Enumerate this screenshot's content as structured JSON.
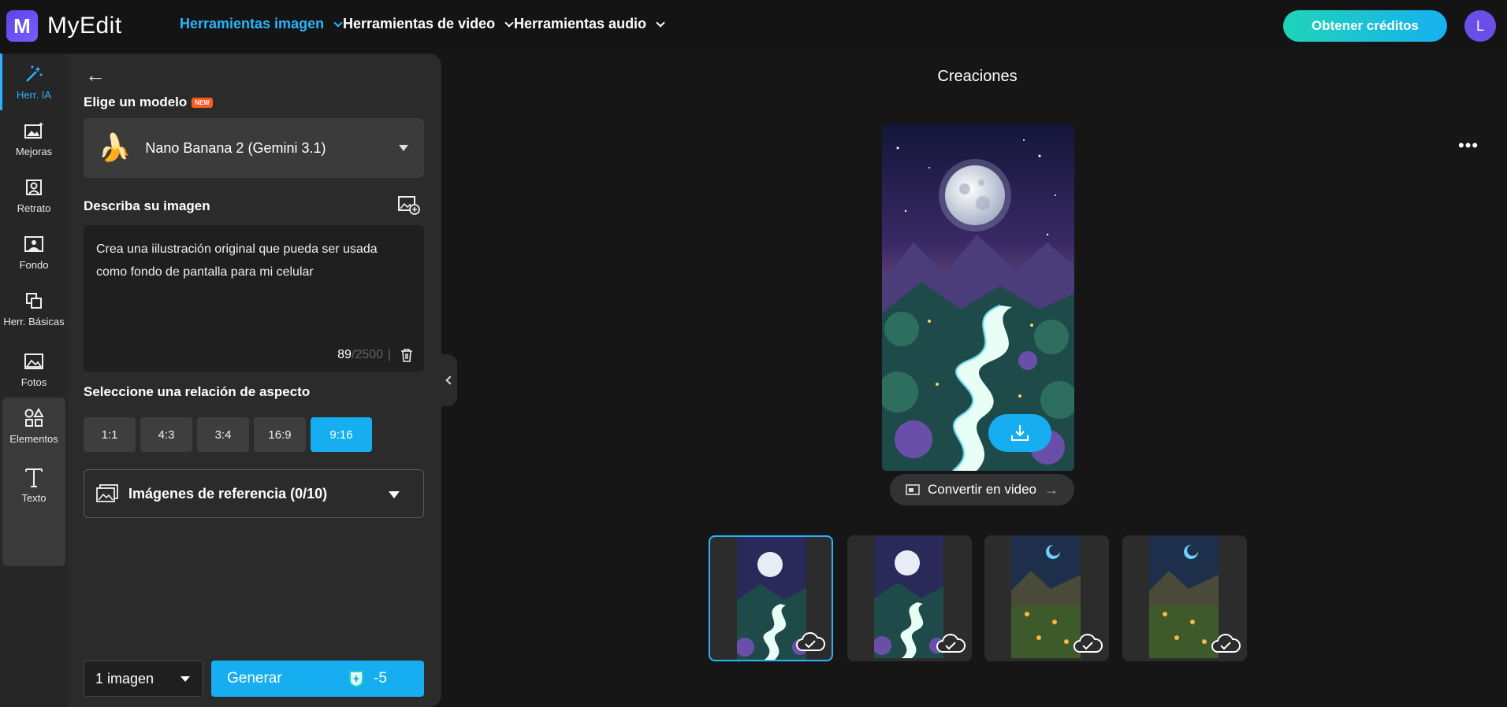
{
  "app": {
    "name": "MyEdit",
    "logo_letter": "M",
    "avatar_letter": "L"
  },
  "nav": {
    "image_tools": "Herramientas imagen",
    "video_tools": "Herramientas de video",
    "audio_tools": "Herramientas audio",
    "credits_button": "Obtener créditos"
  },
  "rail": {
    "items": [
      {
        "label": "Herr. IA",
        "icon": "magic-wand-icon"
      },
      {
        "label": "Mejoras",
        "icon": "image-enhance-icon"
      },
      {
        "label": "Retrato",
        "icon": "portrait-icon"
      },
      {
        "label": "Fondo",
        "icon": "background-icon"
      },
      {
        "label": "Herr. Básicas",
        "icon": "crop-icon"
      },
      {
        "label": "Fotos",
        "icon": "photo-icon"
      },
      {
        "label": "Elementos",
        "icon": "shapes-icon"
      },
      {
        "label": "Texto",
        "icon": "text-icon"
      }
    ]
  },
  "panel": {
    "model_label": "Elige un modelo",
    "new_badge": "NEW",
    "model_name": "Nano Banana 2 (Gemini 3.1)",
    "model_emoji": "🍌",
    "describe_label": "Describa su imagen",
    "prompt": "Crea una iilustración original que pueda ser usada como fondo de pantalla para mi celular",
    "char_count": "89",
    "char_max": "/2500",
    "char_sep": "|",
    "ratio_label": "Seleccione una relación de aspecto",
    "ratios": [
      "1:1",
      "4:3",
      "3:4",
      "16:9",
      "9:16"
    ],
    "selected_ratio": "9:16",
    "reference_label": "Imágenes de referencia (0/10)",
    "image_count": "1 imagen",
    "generate_label": "Generar",
    "generate_cost": "-5"
  },
  "main": {
    "title": "Creaciones",
    "more": "•••",
    "convert_label": "Convertir en video",
    "thumbnails": [
      {
        "style": "moon-river",
        "selected": true
      },
      {
        "style": "moon-river",
        "selected": false
      },
      {
        "style": "forest-crescent",
        "selected": false
      },
      {
        "style": "forest-crescent",
        "selected": false
      }
    ]
  },
  "colors": {
    "accent": "#16aef0",
    "badge": "#ff5a1f",
    "credits_gradient_start": "#1fd4b8",
    "credits_gradient_end": "#17b0f0"
  }
}
